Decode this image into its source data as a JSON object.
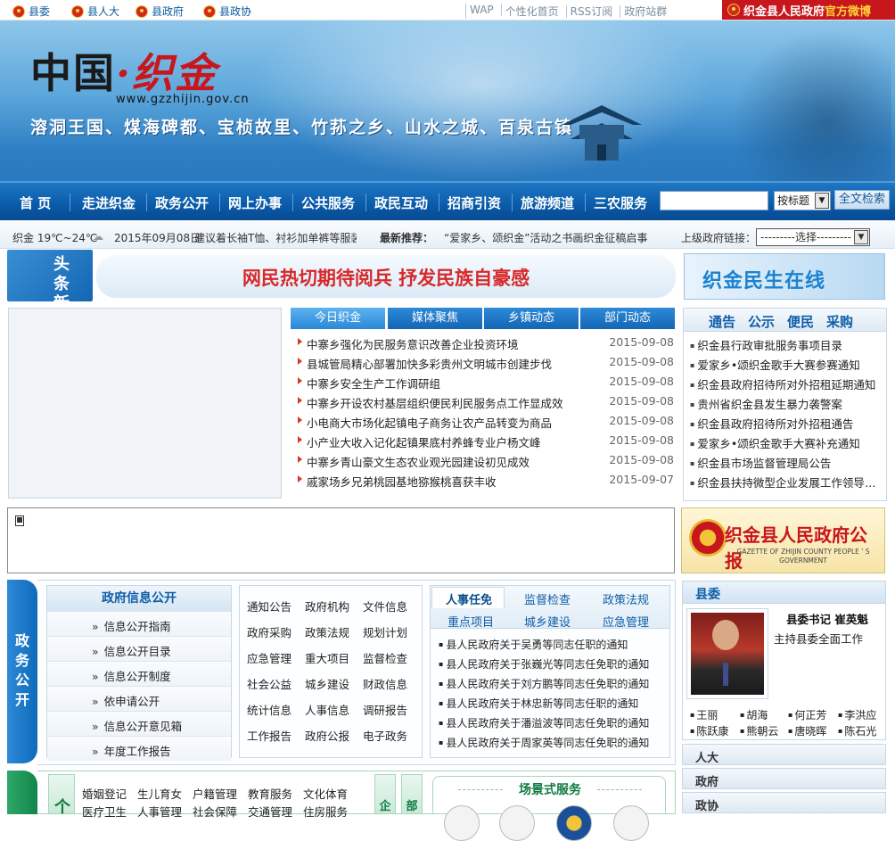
{
  "topbar": {
    "orgs": [
      "县委",
      "县人大",
      "县政府",
      "县政协"
    ],
    "links": [
      "WAP",
      "个性化首页",
      "RSS订阅",
      "政府站群"
    ],
    "weibo_a": "织金县人民政府",
    "weibo_b": "官方微博"
  },
  "banner": {
    "logo_left": "中国",
    "logo_dot": "·",
    "logo_right": "织金",
    "url": "www.gzzhijin.gov.cn",
    "slogan": "溶洞王国、煤海碑都、宝桢故里、竹荪之乡、山水之城、百泉古镇"
  },
  "nav": {
    "items": [
      "首 页",
      "走进织金",
      "政务公开",
      "网上办事",
      "公共服务",
      "政民互动",
      "招商引资",
      "旅游频道",
      "三农服务"
    ],
    "search_select": "按标题",
    "search_button": "全文检索"
  },
  "infobar": {
    "weather": "织金 19℃~24℃",
    "date": "2015年09月08日",
    "tip": "建议着长袖T恤、衬衫加单裤等服装",
    "rec_label": "最新推荐：",
    "rec_text": "“爱家乡、颂织金”活动之书画织金征稿启事",
    "sup_label": "上级政府链接：",
    "sup_select": "---------选择---------"
  },
  "headline": {
    "tag": "头条新闻",
    "title": "网民热切期待阅兵  抒发民族自豪感"
  },
  "minsheng": "织金民生在线",
  "news_tabs": [
    "今日织金",
    "媒体聚焦",
    "乡镇动态",
    "部门动态"
  ],
  "news": [
    {
      "title": "中寨乡强化为民服务意识改善企业投资环境",
      "date": "2015-09-08"
    },
    {
      "title": "县城管局精心部署加快多彩贵州文明城市创建步伐",
      "date": "2015-09-08"
    },
    {
      "title": "中寨乡安全生产工作调研组",
      "date": "2015-09-08"
    },
    {
      "title": "中寨乡开设农村基层组织便民利民服务点工作显成效",
      "date": "2015-09-08"
    },
    {
      "title": "小电商大市场化起镇电子商务让农产品转变为商品",
      "date": "2015-09-08"
    },
    {
      "title": "小产业大收入记化起镇果底村养蜂专业户杨文峰",
      "date": "2015-09-08"
    },
    {
      "title": "中寨乡青山豪文生态农业观光园建设初见成效",
      "date": "2015-09-08"
    },
    {
      "title": "戚家场乡兄弟桃园基地猕猴桃喜获丰收",
      "date": "2015-09-07"
    }
  ],
  "notice_tabs": [
    "通告",
    "公示",
    "便民",
    "采购"
  ],
  "notices": [
    "织金县行政审批服务事项目录",
    "爱家乡•颂织金歌手大赛参赛通知",
    "织金县政府招待所对外招租延期通知",
    "贵州省织金县发生暴力袭警案",
    "织金县政府招待所对外招租通告",
    "爱家乡•颂织金歌手大赛补充通知",
    "织金县市场监督管理局公告",
    "织金县扶持微型企业发展工作领导小组"
  ],
  "gazette": {
    "title": "织金县人民政府公报",
    "en": "GAZETTE OF ZHIJIN COUNTY PEOPLE ' S GOVERNMENT"
  },
  "gov": {
    "side": "政务公开",
    "disclosure_title": "政府信息公开",
    "disclosure_items": [
      "信息公开指南",
      "信息公开目录",
      "信息公开制度",
      "依申请公开",
      "信息公开意见箱",
      "年度工作报告"
    ],
    "links": [
      [
        "通知公告",
        "政府机构",
        "文件信息"
      ],
      [
        "政府采购",
        "政策法规",
        "规划计划"
      ],
      [
        "应急管理",
        "重大项目",
        "监督检查"
      ],
      [
        "社会公益",
        "城乡建设",
        "财政信息"
      ],
      [
        "统计信息",
        "人事信息",
        "调研报告"
      ],
      [
        "工作报告",
        "政府公报",
        "电子政务"
      ]
    ],
    "ptabs_row1": [
      "人事任免",
      "监督检查",
      "政策法规"
    ],
    "ptabs_row2": [
      "重点项目",
      "城乡建设",
      "应急管理"
    ],
    "personnel": [
      "县人民政府关于吴勇等同志任职的通知",
      "县人民政府关于张巍光等同志任免职的通知",
      "县人民政府关于刘方鹏等同志任免职的通知",
      "县人民政府关于林忠新等同志任职的通知",
      "县人民政府关于潘溢波等同志任免职的通知",
      "县人民政府关于周家英等同志任免职的通知"
    ]
  },
  "committee": {
    "head": "县委",
    "sec_title": "县委书记  崔英魁",
    "sec_role": "主持县委全面工作",
    "members": [
      "王丽",
      "胡海",
      "何正芳",
      "李洪应",
      "陈跃康",
      "熊朝云",
      "唐晓晖",
      "陈石光"
    ],
    "bars": [
      "人大",
      "政府",
      "政协"
    ]
  },
  "bottom": {
    "label": "个",
    "row1": [
      "婚姻登记",
      "生儿育女",
      "户籍管理",
      "教育服务",
      "文化体育"
    ],
    "row2": [
      "医疗卫生",
      "人事管理",
      "社会保障",
      "交通管理",
      "住房服务"
    ],
    "vtabs": [
      "企",
      "部"
    ],
    "scene": "场景式服务"
  }
}
